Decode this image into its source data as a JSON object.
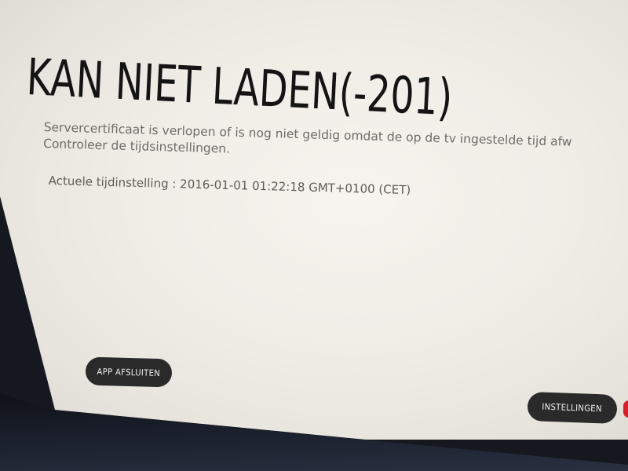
{
  "error": {
    "title": "KAN NIET LADEN(-201)",
    "message_line1": "Servercertificaat is verlopen of is nog niet geldig omdat de op de tv ingestelde tijd afw",
    "message_line2": "Controleer de tijdsinstellingen.",
    "current_time": "Actuele tijdinstelling : 2016-01-01 01:22:18 GMT+0100 (CET)"
  },
  "buttons": {
    "exit_label": "APP AFSLUITEN",
    "settings_label": "INSTELLINGEN"
  },
  "colors": {
    "screen_background": "#efede6",
    "title_text": "#141414",
    "body_text": "#6e6c68",
    "button_background": "#2a2a2a",
    "button_text": "#eeeeee",
    "accent_red": "#d8202a"
  }
}
